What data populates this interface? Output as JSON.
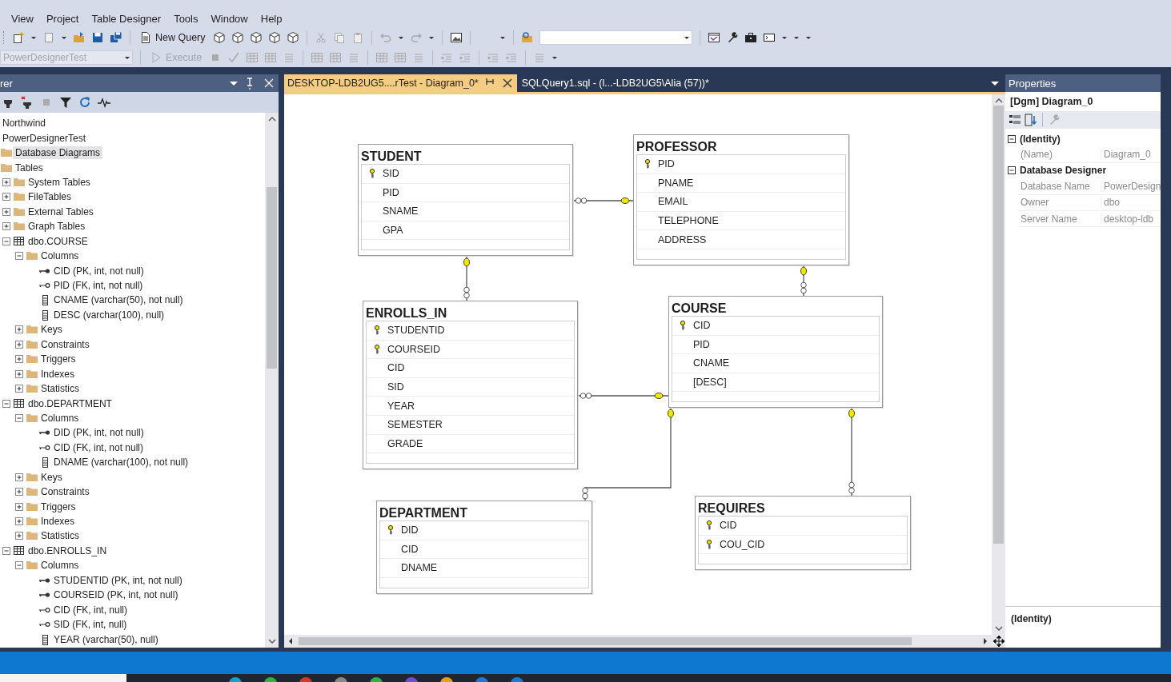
{
  "menu": [
    "View",
    "Project",
    "Table Designer",
    "Tools",
    "Window",
    "Help"
  ],
  "toolbar": {
    "new_query": "New Query",
    "database": {
      "value": "PowerDesignerTest",
      "disabled": true
    },
    "execute": {
      "label": "Execute",
      "disabled": true
    }
  },
  "object_explorer": {
    "title": "rer",
    "tree": [
      {
        "label": "Northwind",
        "selected": false
      },
      {
        "label": "PowerDesignerTest",
        "selected": false,
        "children": [
          {
            "label": "Database Diagrams",
            "kind": "folder",
            "selected": true
          },
          {
            "label": "Tables",
            "kind": "folder",
            "selected": false,
            "children": [
              {
                "label": "System Tables",
                "kind": "folder",
                "expanded": false,
                "selected": false
              },
              {
                "label": "FileTables",
                "kind": "folder",
                "expanded": false,
                "selected": false
              },
              {
                "label": "External Tables",
                "kind": "folder",
                "expanded": false,
                "selected": false
              },
              {
                "label": "Graph Tables",
                "kind": "folder",
                "expanded": false,
                "selected": false
              },
              {
                "label": "dbo.COURSE",
                "kind": "table",
                "expanded": true,
                "selected": false,
                "children": [
                  {
                    "label": "Columns",
                    "kind": "folder",
                    "expanded": true,
                    "selected": false,
                    "children": [
                      {
                        "label": "CID (PK, int, not null)",
                        "kind": "pk",
                        "selected": false
                      },
                      {
                        "label": "PID (FK, int, not null)",
                        "kind": "fk",
                        "selected": false
                      },
                      {
                        "label": "CNAME (varchar(50), not null)",
                        "kind": "column",
                        "selected": false
                      },
                      {
                        "label": "DESC (varchar(100), null)",
                        "kind": "column",
                        "selected": false
                      }
                    ]
                  },
                  {
                    "label": "Keys",
                    "kind": "folder",
                    "expanded": false,
                    "selected": false
                  },
                  {
                    "label": "Constraints",
                    "kind": "folder",
                    "expanded": false,
                    "selected": false
                  },
                  {
                    "label": "Triggers",
                    "kind": "folder",
                    "expanded": false,
                    "selected": false
                  },
                  {
                    "label": "Indexes",
                    "kind": "folder",
                    "expanded": false,
                    "selected": false
                  },
                  {
                    "label": "Statistics",
                    "kind": "folder",
                    "expanded": false,
                    "selected": false
                  }
                ]
              },
              {
                "label": "dbo.DEPARTMENT",
                "kind": "table",
                "expanded": true,
                "selected": false,
                "children": [
                  {
                    "label": "Columns",
                    "kind": "folder",
                    "expanded": true,
                    "selected": false,
                    "children": [
                      {
                        "label": "DID (PK, int, not null)",
                        "kind": "pk",
                        "selected": false
                      },
                      {
                        "label": "CID (FK, int, not null)",
                        "kind": "fk",
                        "selected": false
                      },
                      {
                        "label": "DNAME (varchar(100), not null)",
                        "kind": "column",
                        "selected": false
                      }
                    ]
                  },
                  {
                    "label": "Keys",
                    "kind": "folder",
                    "expanded": false,
                    "selected": false
                  },
                  {
                    "label": "Constraints",
                    "kind": "folder",
                    "expanded": false,
                    "selected": false
                  },
                  {
                    "label": "Triggers",
                    "kind": "folder",
                    "expanded": false,
                    "selected": false
                  },
                  {
                    "label": "Indexes",
                    "kind": "folder",
                    "expanded": false,
                    "selected": false
                  },
                  {
                    "label": "Statistics",
                    "kind": "folder",
                    "expanded": false,
                    "selected": false
                  }
                ]
              },
              {
                "label": "dbo.ENROLLS_IN",
                "kind": "table",
                "expanded": true,
                "selected": false,
                "children": [
                  {
                    "label": "Columns",
                    "kind": "folder",
                    "expanded": true,
                    "selected": false,
                    "children": [
                      {
                        "label": "STUDENTID (PK, int, not null)",
                        "kind": "pk",
                        "selected": false
                      },
                      {
                        "label": "COURSEID (PK, int, not null)",
                        "kind": "pk",
                        "selected": false
                      },
                      {
                        "label": "CID (FK, int, null)",
                        "kind": "fk",
                        "selected": false
                      },
                      {
                        "label": "SID (FK, int, null)",
                        "kind": "fk",
                        "selected": false
                      },
                      {
                        "label": "YEAR (varchar(50), null)",
                        "kind": "column",
                        "selected": false
                      }
                    ]
                  }
                ]
              }
            ]
          }
        ]
      }
    ]
  },
  "tabs": [
    {
      "label": "DESKTOP-LDB2UG5....rTest - Diagram_0*",
      "selected": true
    },
    {
      "label": "SQLQuery1.sql - (l...-LDB2UG5\\Alia (57))*",
      "selected": false
    }
  ],
  "diagram": {
    "tables": [
      {
        "name": "STUDENT",
        "columns": [
          {
            "name": "SID",
            "key": true
          },
          {
            "name": "PID",
            "key": false
          },
          {
            "name": "SNAME",
            "key": false
          },
          {
            "name": "GPA",
            "key": false
          }
        ]
      },
      {
        "name": "PROFESSOR",
        "columns": [
          {
            "name": "PID",
            "key": true
          },
          {
            "name": "PNAME",
            "key": false
          },
          {
            "name": "EMAIL",
            "key": false
          },
          {
            "name": "TELEPHONE",
            "key": false
          },
          {
            "name": "ADDRESS",
            "key": false
          }
        ]
      },
      {
        "name": "ENROLLS_IN",
        "columns": [
          {
            "name": "STUDENTID",
            "key": true
          },
          {
            "name": "COURSEID",
            "key": true
          },
          {
            "name": "CID",
            "key": false
          },
          {
            "name": "SID",
            "key": false
          },
          {
            "name": "YEAR",
            "key": false
          },
          {
            "name": "SEMESTER",
            "key": false
          },
          {
            "name": "GRADE",
            "key": false
          }
        ]
      },
      {
        "name": "COURSE",
        "columns": [
          {
            "name": "CID",
            "key": true
          },
          {
            "name": "PID",
            "key": false
          },
          {
            "name": "CNAME",
            "key": false
          },
          {
            "name": "[DESC]",
            "key": false
          }
        ]
      },
      {
        "name": "DEPARTMENT",
        "columns": [
          {
            "name": "DID",
            "key": true
          },
          {
            "name": "CID",
            "key": false
          },
          {
            "name": "DNAME",
            "key": false
          }
        ]
      },
      {
        "name": "REQUIRES",
        "columns": [
          {
            "name": "CID",
            "key": true
          },
          {
            "name": "COU_CID",
            "key": true
          }
        ]
      }
    ]
  },
  "properties": {
    "title": "Properties",
    "object": "[Dgm] Diagram_0",
    "categories": [
      {
        "name": "(Identity)",
        "expanded": true,
        "rows": [
          {
            "name": "(Name)",
            "value": "Diagram_0"
          }
        ]
      },
      {
        "name": "Database Designer",
        "expanded": true,
        "rows": [
          {
            "name": "Database Name",
            "value": "PowerDesign"
          },
          {
            "name": "Owner",
            "value": "dbo"
          },
          {
            "name": "Server Name",
            "value": "desktop-ldb"
          }
        ]
      }
    ],
    "description": "(Identity)"
  }
}
